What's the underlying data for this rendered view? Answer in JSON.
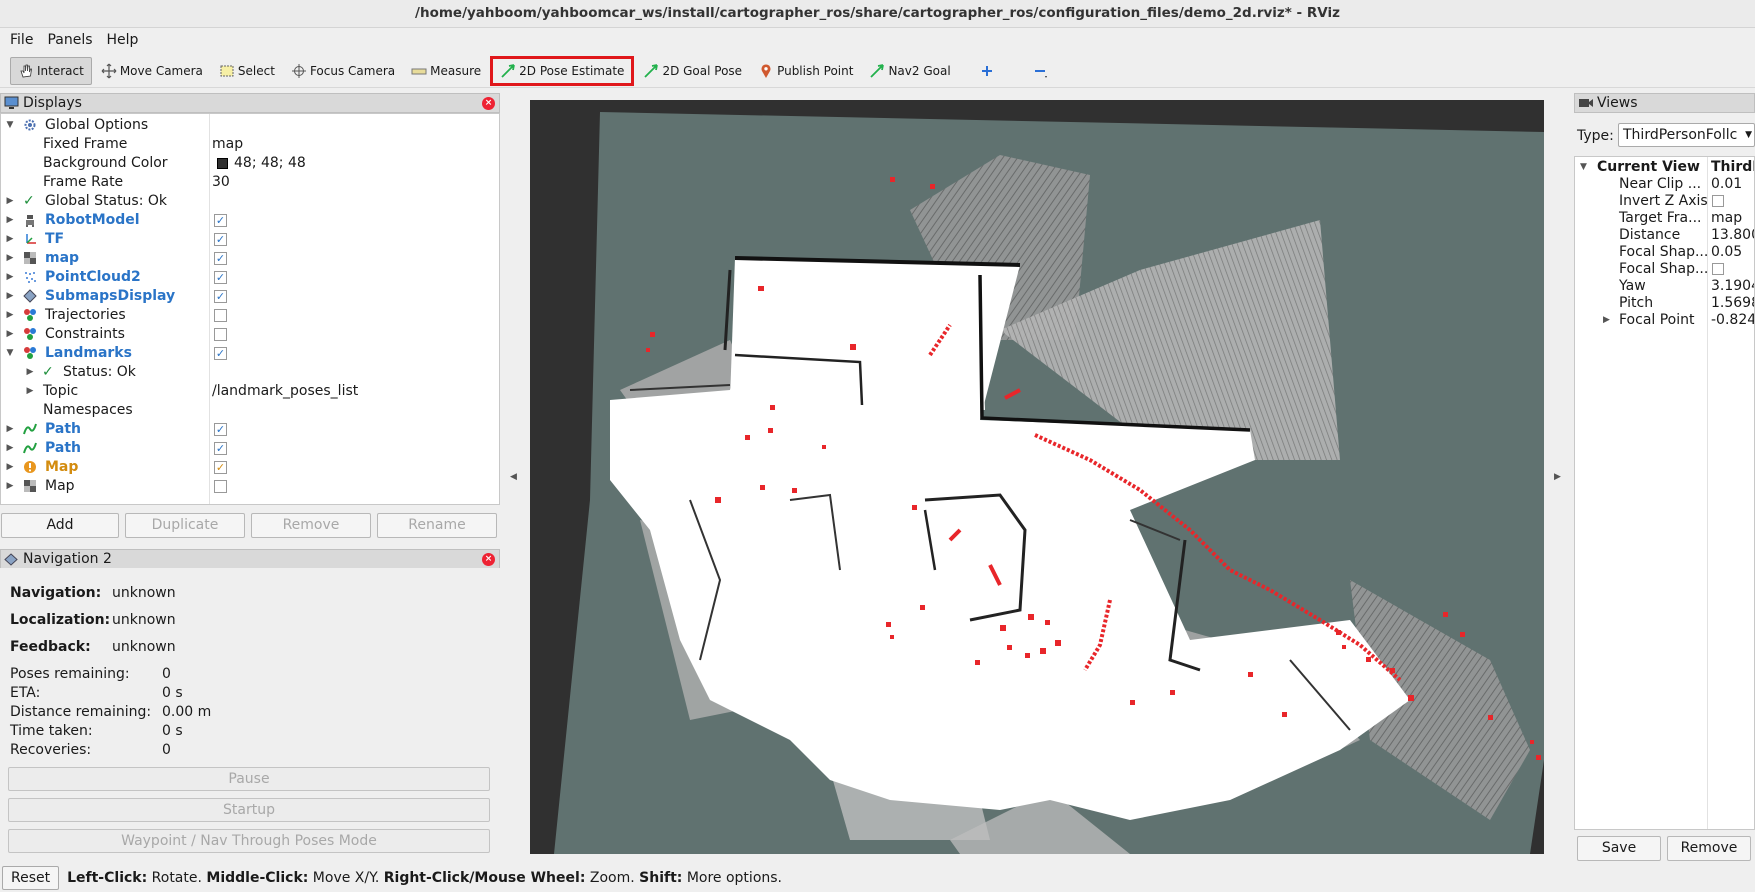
{
  "window": {
    "title": "/home/yahboom/yahboomcar_ws/install/cartographer_ros/share/cartographer_ros/configuration_files/demo_2d.rviz* - RViz"
  },
  "menu": {
    "file": "File",
    "panels": "Panels",
    "help": "Help"
  },
  "toolbar": {
    "interact": "Interact",
    "move_camera": "Move Camera",
    "select": "Select",
    "focus_camera": "Focus Camera",
    "measure": "Measure",
    "pose_estimate": "2D Pose Estimate",
    "goal_pose": "2D Goal Pose",
    "publish_point": "Publish Point",
    "nav2_goal": "Nav2 Goal"
  },
  "displays": {
    "title": "Displays",
    "global_options": "Global Options",
    "fixed_frame_label": "Fixed Frame",
    "fixed_frame_value": "map",
    "bg_color_label": "Background Color",
    "bg_color_value": "48; 48; 48",
    "frame_rate_label": "Frame Rate",
    "frame_rate_value": "30",
    "global_status": "Global Status: Ok",
    "items": {
      "robotmodel": "RobotModel",
      "tf": "TF",
      "map": "map",
      "pointcloud2": "PointCloud2",
      "submaps": "SubmapsDisplay",
      "trajectories": "Trajectories",
      "constraints": "Constraints",
      "landmarks": "Landmarks",
      "landmarks_status": "Status: Ok",
      "topic_label": "Topic",
      "topic_value": "/landmark_poses_list",
      "namespaces_label": "Namespaces",
      "path1": "Path",
      "path2": "Path",
      "map_orange": "Map",
      "map_last": "Map"
    },
    "buttons": {
      "add": "Add",
      "duplicate": "Duplicate",
      "remove": "Remove",
      "rename": "Rename"
    }
  },
  "navigation": {
    "title": "Navigation 2",
    "navigation_label": "Navigation:",
    "navigation_value": "unknown",
    "localization_label": "Localization:",
    "localization_value": "unknown",
    "feedback_label": "Feedback:",
    "feedback_value": "unknown",
    "poses_label": "Poses remaining:",
    "poses_value": "0",
    "eta_label": "ETA:",
    "eta_value": "0 s",
    "distance_label": "Distance remaining:",
    "distance_value": "0.00 m",
    "time_label": "Time taken:",
    "time_value": "0 s",
    "recoveries_label": "Recoveries:",
    "recoveries_value": "0",
    "pause": "Pause",
    "startup": "Startup",
    "waypoint": "Waypoint / Nav Through Poses Mode"
  },
  "views": {
    "title": "Views",
    "type_label": "Type:",
    "type_value": "ThirdPersonFollc",
    "current_view": "Current View",
    "current_view_value": "ThirdP",
    "near_clip": "Near Clip ...",
    "near_clip_value": "0.01",
    "invert_z": "Invert Z Axis",
    "target_frame": "Target Fra...",
    "target_frame_value": "map",
    "distance": "Distance",
    "distance_value": "13.800",
    "focal_shape1": "Focal Shap...",
    "focal_shape1_value": "0.05",
    "focal_shape2": "Focal Shap...",
    "yaw": "Yaw",
    "yaw_value": "3.1904",
    "pitch": "Pitch",
    "pitch_value": "1.5698",
    "focal_point": "Focal Point",
    "focal_point_value": "-0.824",
    "save": "Save",
    "remove": "Remove"
  },
  "status": {
    "reset": "Reset",
    "lc": "Left-Click:",
    "lc_t": " Rotate. ",
    "mc": "Middle-Click:",
    "mc_t": " Move X/Y. ",
    "rc": "Right-Click/Mouse Wheel:",
    "rc_t": " Zoom. ",
    "sh": "Shift:",
    "sh_t": " More options."
  },
  "colors": {
    "highlight": "#e0171b",
    "path_red": "#e8262a",
    "floor": "#607270",
    "bg": "#303030"
  }
}
